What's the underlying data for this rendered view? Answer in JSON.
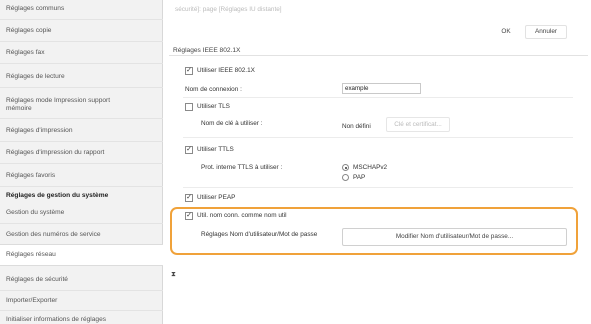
{
  "sidebar": {
    "items": [
      {
        "label": "Réglages communs"
      },
      {
        "label": "Réglages copie"
      },
      {
        "label": "Réglages fax"
      },
      {
        "label": "Réglages de lecture"
      },
      {
        "label": "Réglages mode Impression support",
        "label2": "mémoire"
      },
      {
        "label": "Réglages d'impression"
      },
      {
        "label": "Réglages d'impression du rapport"
      },
      {
        "label": "Réglages favoris"
      },
      {
        "label": "Réglages de gestion du système"
      },
      {
        "label": "Gestion du système"
      },
      {
        "label": "Gestion des numéros de service"
      },
      {
        "label": "Réglages réseau"
      },
      {
        "label": "Réglages de sécurité"
      },
      {
        "label": "Importer/Exporter"
      },
      {
        "label": "Initialiser informations de réglages"
      }
    ]
  },
  "header": {
    "breadcrumb": "sécurité]: page [Réglages IU distante]",
    "ok_label": "OK",
    "cancel_label": "Annuler"
  },
  "section": {
    "title": "Réglages IEEE 802.1X",
    "use_ieee": {
      "label": "Utiliser IEEE 802.1X",
      "checked": true
    },
    "login_name_label": "Nom de connexion :",
    "login_name_value": "example",
    "use_tls": {
      "label": "Utiliser TLS",
      "checked": false
    },
    "key_label": "Nom de clé à utiliser :",
    "key_value": "Non défini",
    "key_button": "Clé et certificat...",
    "use_ttls": {
      "label": "Utiliser TTLS",
      "checked": true
    },
    "ttls_protocol_label": "Prot. interne TTLS à utiliser :",
    "ttls_options": [
      {
        "label": "MSCHAPv2",
        "selected": true
      },
      {
        "label": "PAP",
        "selected": false
      }
    ],
    "use_peap": {
      "label": "Utiliser PEAP",
      "checked": false
    },
    "use_conn_name": {
      "label": "Util. nom conn. comme nom util",
      "checked": true
    },
    "username_settings_label": "Réglages Nom d'utilisateur/Mot de passe",
    "username_button": "Modifier Nom d'utilisateur/Mot de passe..."
  },
  "colors": {
    "highlight": "#f0a23a",
    "sidebar_bg": "#f2f2f2"
  }
}
